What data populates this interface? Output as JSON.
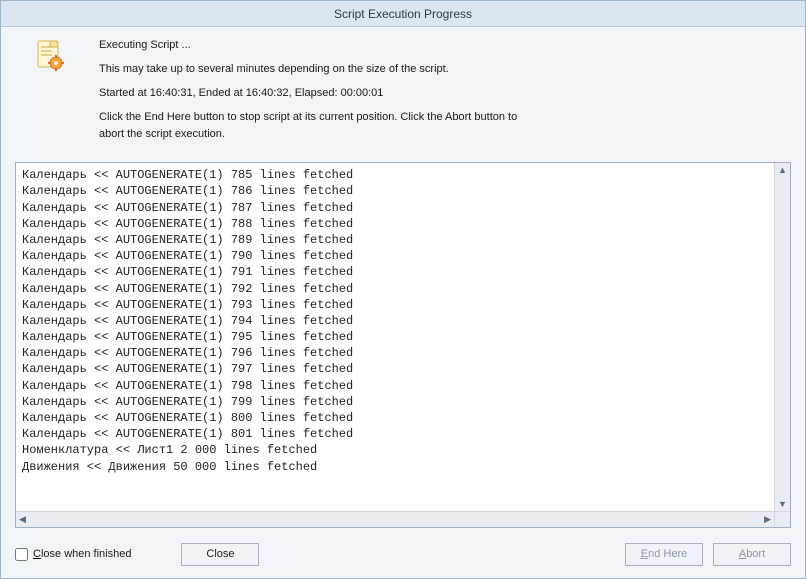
{
  "title": "Script Execution Progress",
  "messages": {
    "executing": "Executing Script ...",
    "note": "This may take up to several minutes depending on the size of the script.",
    "timing": "Started at 16:40:31, Ended at 16:40:32,  Elapsed: 00:00:01",
    "instr": "Click the End Here button to stop script at its current position. Click the Abort button to abort the script execution."
  },
  "log": [
    "Календарь << AUTOGENERATE(1) 785 lines fetched",
    "Календарь << AUTOGENERATE(1) 786 lines fetched",
    "Календарь << AUTOGENERATE(1) 787 lines fetched",
    "Календарь << AUTOGENERATE(1) 788 lines fetched",
    "Календарь << AUTOGENERATE(1) 789 lines fetched",
    "Календарь << AUTOGENERATE(1) 790 lines fetched",
    "Календарь << AUTOGENERATE(1) 791 lines fetched",
    "Календарь << AUTOGENERATE(1) 792 lines fetched",
    "Календарь << AUTOGENERATE(1) 793 lines fetched",
    "Календарь << AUTOGENERATE(1) 794 lines fetched",
    "Календарь << AUTOGENERATE(1) 795 lines fetched",
    "Календарь << AUTOGENERATE(1) 796 lines fetched",
    "Календарь << AUTOGENERATE(1) 797 lines fetched",
    "Календарь << AUTOGENERATE(1) 798 lines fetched",
    "Календарь << AUTOGENERATE(1) 799 lines fetched",
    "Календарь << AUTOGENERATE(1) 800 lines fetched",
    "Календарь << AUTOGENERATE(1) 801 lines fetched",
    "Номенклатура << Лист1 2 000 lines fetched",
    "Движения << Движения 50 000 lines fetched"
  ],
  "buttons": {
    "close": "Close",
    "endhere": "End Here",
    "abort": "Abort"
  },
  "checkbox": {
    "label_pre": "C",
    "label_rest": "lose when finished"
  },
  "scroll": {
    "up": "▲",
    "down": "▼",
    "left": "◀",
    "right": "▶"
  }
}
